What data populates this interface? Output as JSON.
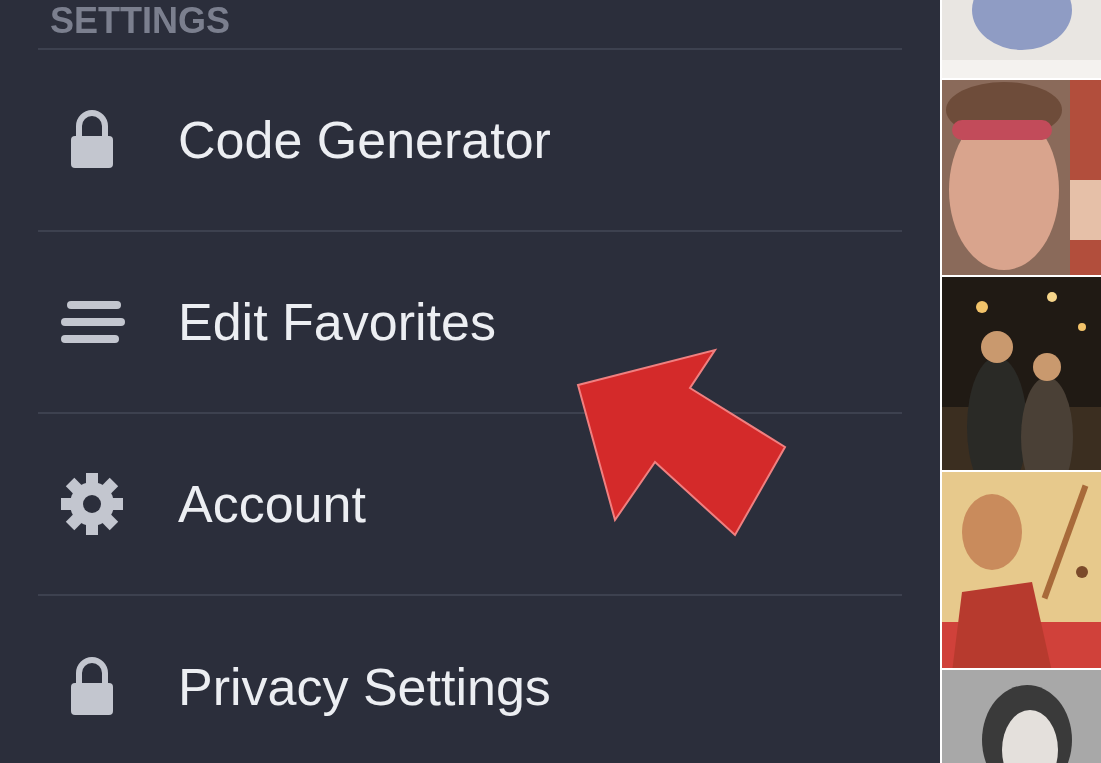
{
  "section_header": "SETTINGS",
  "items": [
    {
      "kind": "lock",
      "label": "Code Generator"
    },
    {
      "kind": "lines",
      "label": "Edit Favorites"
    },
    {
      "kind": "gear",
      "label": "Account"
    },
    {
      "kind": "lock",
      "label": "Privacy Settings"
    }
  ],
  "annotation": {
    "kind": "arrow"
  }
}
